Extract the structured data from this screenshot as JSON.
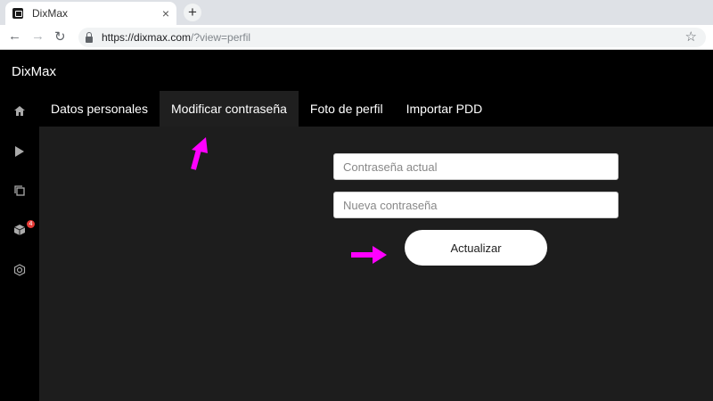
{
  "browser": {
    "tab_title": "DixMax",
    "tab_close": "×",
    "new_tab": "+",
    "url_main": "https://dixmax.com",
    "url_rest": "/?view=perfil"
  },
  "app": {
    "brand": "DixMax",
    "sidebar": {
      "badge_count": "4",
      "icons": [
        "home-icon",
        "play-icon",
        "copy-icon",
        "cube-icon",
        "hexagon-icon"
      ]
    },
    "tabs": [
      {
        "label": "Datos personales",
        "active": false
      },
      {
        "label": "Modificar contraseña",
        "active": true
      },
      {
        "label": "Foto de perfil",
        "active": false
      },
      {
        "label": "Importar PDD",
        "active": false
      }
    ],
    "form": {
      "current_password_placeholder": "Contraseña actual",
      "new_password_placeholder": "Nueva contraseña",
      "submit_label": "Actualizar"
    },
    "annotation_color": "#ff00ff",
    "accent_color": "#ffffff"
  }
}
